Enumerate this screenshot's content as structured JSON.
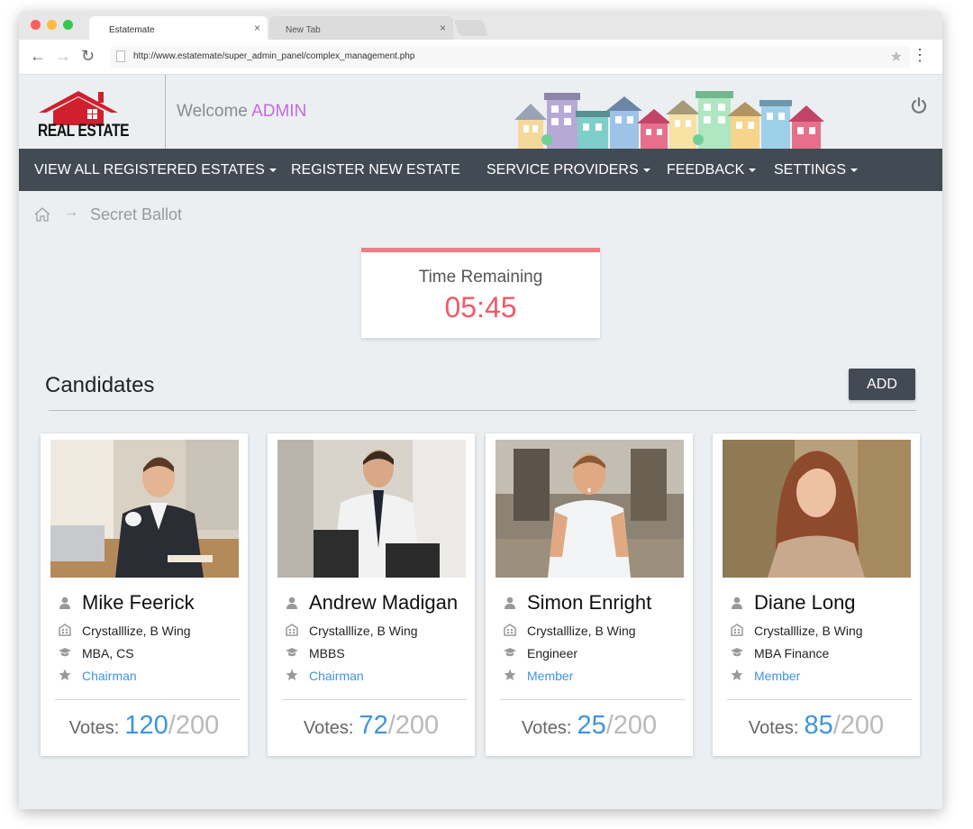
{
  "browser": {
    "tabs": [
      {
        "title": "Estatemate",
        "close": "×"
      },
      {
        "title": "New Tab",
        "close": "×"
      }
    ],
    "url": "http://www.estatemate/super_admin_panel/complex_management.php",
    "nav": {
      "back": "←",
      "forward": "→",
      "reload": "↻",
      "star": "★",
      "menu": "⋮"
    }
  },
  "header": {
    "logo_text": "REAL ESTATE",
    "welcome": "Welcome",
    "user": "ADMIN",
    "power_icon": "power-icon"
  },
  "navbar": {
    "items": [
      {
        "label": "VIEW ALL REGISTERED ESTATES",
        "dropdown": true
      },
      {
        "label": "REGISTER NEW ESTATE",
        "dropdown": false
      },
      {
        "label": "SERVICE PROVIDERS",
        "dropdown": true
      },
      {
        "label": "FEEDBACK",
        "dropdown": true
      },
      {
        "label": "SETTINGS",
        "dropdown": true
      }
    ]
  },
  "breadcrumb": {
    "arrow": "→",
    "current": "Secret Ballot"
  },
  "timer": {
    "label": "Time Remaining",
    "value": "05:45"
  },
  "candidates": {
    "title": "Candidates",
    "add_label": "ADD",
    "votes_label": "Votes:",
    "items": [
      {
        "name": "Mike Feerick",
        "building": "Crystalllize, B Wing",
        "qualification": "MBA, CS",
        "role": "Chairman",
        "votes": "120",
        "total": "/200"
      },
      {
        "name": "Andrew Madigan",
        "building": "Crystalllize, B Wing",
        "qualification": "MBBS",
        "role": "Chairman",
        "votes": "72",
        "total": "/200"
      },
      {
        "name": "Simon Enright",
        "building": "Crystalllize, B Wing",
        "qualification": "Engineer",
        "role": "Member",
        "votes": "25",
        "total": "/200"
      },
      {
        "name": "Diane Long",
        "building": "Crystalllize, B Wing",
        "qualification": "MBA Finance",
        "role": "Member",
        "votes": "85",
        "total": "/200"
      }
    ]
  },
  "colors": {
    "nav_bg": "#424a53",
    "accent_blue": "#3e94e0",
    "timer_red": "#ef5b69",
    "admin_purple": "#c26be0",
    "logo_red": "#d0202e"
  }
}
